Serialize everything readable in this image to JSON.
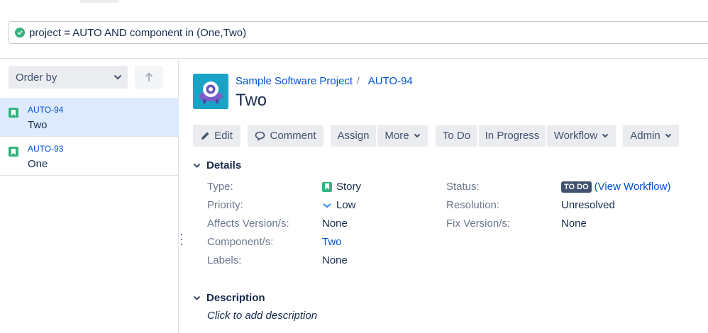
{
  "search": {
    "jql": "project = AUTO AND component in (One,Two)"
  },
  "sidebar": {
    "order_label": "Order by",
    "issues": [
      {
        "key": "AUTO-94",
        "summary": "Two"
      },
      {
        "key": "AUTO-93",
        "summary": "One"
      }
    ]
  },
  "issue": {
    "project_name": "Sample Software Project",
    "key": "AUTO-94",
    "title": "Two"
  },
  "toolbar": {
    "edit": "Edit",
    "comment": "Comment",
    "assign": "Assign",
    "more": "More",
    "todo": "To Do",
    "in_progress": "In Progress",
    "workflow": "Workflow",
    "admin": "Admin"
  },
  "details": {
    "heading": "Details",
    "type_label": "Type:",
    "type_value": "Story",
    "priority_label": "Priority:",
    "priority_value": "Low",
    "affects_label": "Affects Version/s:",
    "affects_value": "None",
    "component_label": "Component/s:",
    "component_value": "Two",
    "labels_label": "Labels:",
    "labels_value": "None",
    "status_label": "Status:",
    "status_value": "TO DO",
    "view_workflow": "(View Workflow)",
    "resolution_label": "Resolution:",
    "resolution_value": "Unresolved",
    "fix_label": "Fix Version/s:",
    "fix_value": "None"
  },
  "description": {
    "heading": "Description",
    "placeholder": "Click to add description"
  },
  "colors": {
    "link": "#0052cc",
    "story": "#36b37e",
    "selected": "#deebff",
    "lozenge": "#42526e"
  },
  "icons": [
    "check-circle-icon",
    "chevron-down-icon",
    "arrow-up-icon",
    "story-icon",
    "pencil-icon",
    "comment-icon",
    "priority-low-icon",
    "project-avatar-icon"
  ]
}
